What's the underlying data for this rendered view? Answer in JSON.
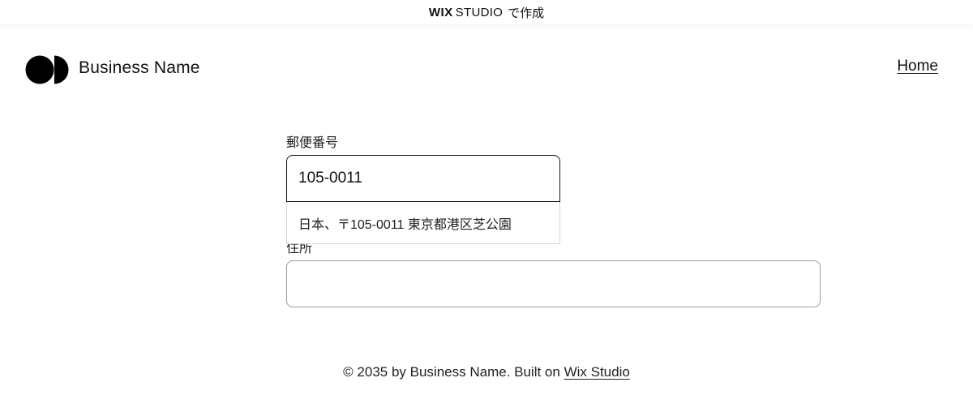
{
  "topbar": {
    "brand_bold": "WIX",
    "brand_light": "STUDIO",
    "suffix": "で作成"
  },
  "header": {
    "logo_icon": "two-halves-logo-icon",
    "business_name": "Business Name",
    "nav": {
      "home_label": "Home"
    }
  },
  "form": {
    "postal": {
      "label": "郵便番号",
      "value": "105-0011"
    },
    "autocomplete": {
      "suggestion": "日本、〒105-0011 東京都港区芝公園"
    },
    "address": {
      "label": "住所",
      "value": ""
    }
  },
  "footer": {
    "text": "© 2035 by Business Name. Built on ",
    "link_label": "Wix Studio"
  },
  "colors": {
    "text": "#111111",
    "border_active": "#111111",
    "border_default": "#9a9a9a"
  }
}
